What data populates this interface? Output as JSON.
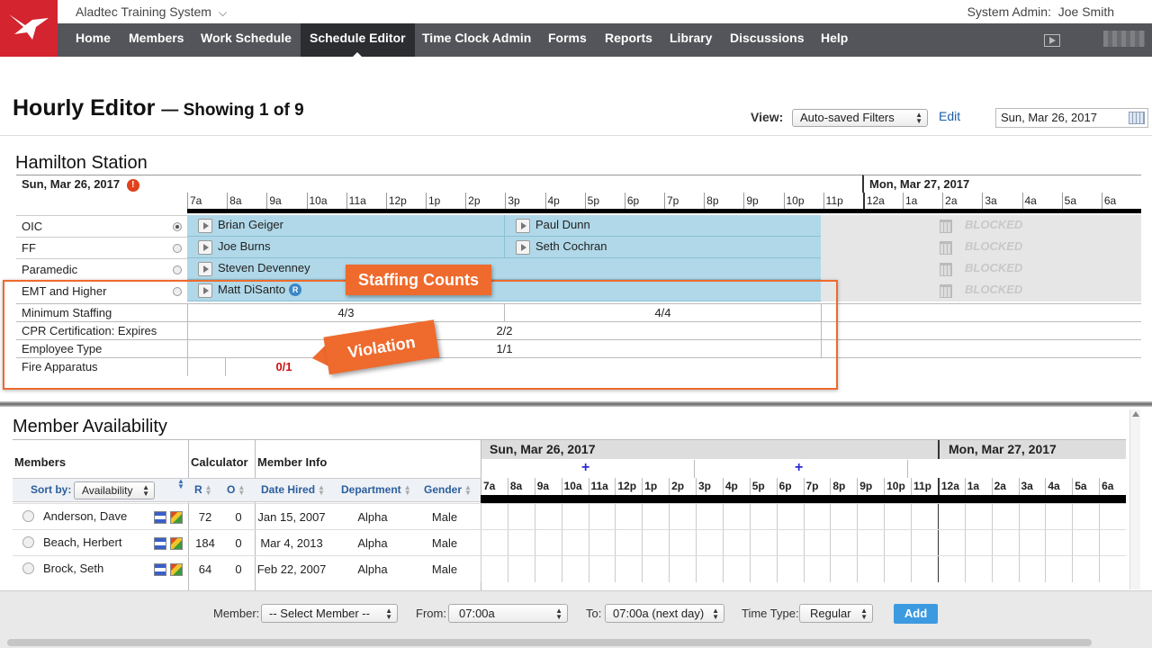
{
  "app": {
    "name": "Aladtec Training System",
    "user_label": "System Admin:",
    "user_name": "Joe Smith"
  },
  "nav": {
    "items": [
      "Home",
      "Members",
      "Work Schedule",
      "Schedule Editor",
      "Time Clock Admin",
      "Forms",
      "Reports",
      "Library",
      "Discussions",
      "Help"
    ],
    "active": "Schedule Editor"
  },
  "header": {
    "title": "Hourly Editor",
    "subtitle": "— Showing 1 of 9",
    "view_label": "View:",
    "view_value": "Auto-saved Filters",
    "edit_label": "Edit",
    "date_value": "Sun, Mar 26, 2017"
  },
  "station": {
    "name": "Hamilton Station",
    "day1": "Sun, Mar 26, 2017",
    "day2": "Mon, Mar 27, 2017",
    "hours_day1": [
      "7a",
      "8a",
      "9a",
      "10a",
      "11a",
      "12p",
      "1p",
      "2p",
      "3p",
      "4p",
      "5p",
      "6p",
      "7p",
      "8p",
      "9p",
      "10p",
      "11p"
    ],
    "hours_day2": [
      "12a",
      "1a",
      "2a",
      "3a",
      "4a",
      "5a",
      "6a"
    ],
    "positions": [
      {
        "label": "OIC",
        "shift1": "Brian Geiger",
        "shift2": "Paul Dunn",
        "blocked": "BLOCKED"
      },
      {
        "label": "FF",
        "shift1": "Joe Burns",
        "shift2": "Seth Cochran",
        "blocked": "BLOCKED"
      },
      {
        "label": "Paramedic",
        "shift1": "Steven Devenney",
        "blocked": "BLOCKED"
      },
      {
        "label": "EMT and Higher",
        "shift1": "Matt DiSanto",
        "badge": "R",
        "blocked": "BLOCKED"
      }
    ],
    "counts": [
      {
        "label": "Minimum Staffing",
        "values": [
          "4/3",
          "4/4"
        ]
      },
      {
        "label": "CPR Certification: Expires",
        "values": [
          "2/2"
        ]
      },
      {
        "label": "Employee Type",
        "values": [
          "1/1"
        ]
      },
      {
        "label": "Fire Apparatus",
        "values": [
          "0/1"
        ]
      }
    ]
  },
  "callouts": {
    "staffing": "Staffing Counts",
    "violation": "Violation"
  },
  "availability": {
    "title": "Member Availability",
    "headers": {
      "members": "Members",
      "calculator": "Calculator",
      "member_info": "Member Info",
      "sort_by": "Sort by:",
      "sort_value": "Availability",
      "r": "R",
      "o": "O",
      "date_hired": "Date Hired",
      "department": "Department",
      "gender": "Gender"
    },
    "day1": "Sun, Mar 26, 2017",
    "day2": "Mon, Mar 27, 2017",
    "hours_day1": [
      "7a",
      "8a",
      "9a",
      "10a",
      "11a",
      "12p",
      "1p",
      "2p",
      "3p",
      "4p",
      "5p",
      "6p",
      "7p",
      "8p",
      "9p",
      "10p",
      "11p"
    ],
    "hours_day2": [
      "12a",
      "1a",
      "2a",
      "3a",
      "4a",
      "5a",
      "6a"
    ],
    "members": [
      {
        "name": "Anderson, Dave",
        "r": "72",
        "o": "0",
        "hired": "Jan 15, 2007",
        "dept": "Alpha",
        "gender": "Male"
      },
      {
        "name": "Beach, Herbert",
        "r": "184",
        "o": "0",
        "hired": "Mar 4, 2013",
        "dept": "Alpha",
        "gender": "Male"
      },
      {
        "name": "Brock, Seth",
        "r": "64",
        "o": "0",
        "hired": "Feb 22, 2007",
        "dept": "Alpha",
        "gender": "Male"
      }
    ]
  },
  "footer": {
    "member_label": "Member:",
    "member_value": "-- Select Member --",
    "from_label": "From:",
    "from_value": "07:00a",
    "to_label": "To:",
    "to_value": "07:00a (next day)",
    "timetype_label": "Time Type:",
    "timetype_value": "Regular",
    "add_label": "Add"
  },
  "colors": {
    "brand": "#d3242f",
    "nav": "#54555a",
    "shift": "#b0d8e8",
    "callout": "#ee6a2d",
    "link": "#1a5fa8"
  }
}
